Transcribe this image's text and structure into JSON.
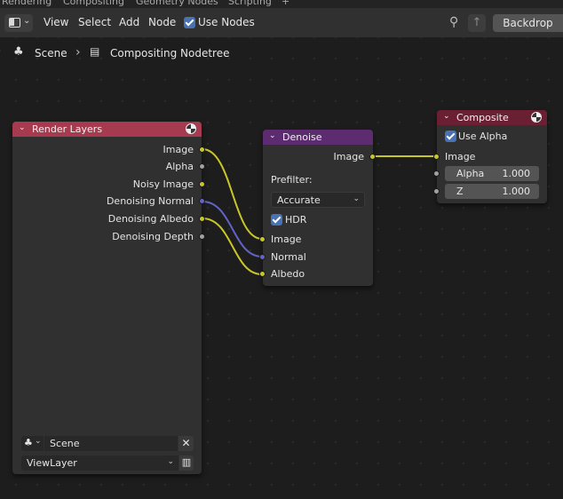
{
  "workspace_tabs": [
    "Rendering",
    "Compositing",
    "Geometry Nodes",
    "Scripting",
    "+"
  ],
  "header": {
    "menus": [
      "View",
      "Select",
      "Add",
      "Node"
    ],
    "use_nodes_label": "Use Nodes",
    "use_nodes_checked": true,
    "backdrop_label": "Backdrop"
  },
  "breadcrumb": {
    "scene": "Scene",
    "separator": "›",
    "nodetree": "Compositing Nodetree"
  },
  "nodes": {
    "render_layers": {
      "title": "Render Layers",
      "header_color": "#a63b4f",
      "outputs": [
        "Image",
        "Alpha",
        "Noisy Image",
        "Denoising Normal",
        "Denoising Albedo",
        "Denoising Depth"
      ],
      "scene_value": "Scene",
      "view_layer_value": "ViewLayer"
    },
    "denoise": {
      "title": "Denoise",
      "header_color": "#5c2b70",
      "output": "Image",
      "prefilter_label": "Prefilter:",
      "prefilter_value": "Accurate",
      "hdr_label": "HDR",
      "hdr_checked": true,
      "inputs": [
        "Image",
        "Normal",
        "Albedo"
      ]
    },
    "composite": {
      "title": "Composite",
      "header_color": "#6b1f33",
      "use_alpha_label": "Use Alpha",
      "use_alpha_checked": true,
      "input_image": "Image",
      "alpha_label": "Alpha",
      "alpha_value": "1.000",
      "z_label": "Z",
      "z_value": "1.000"
    }
  },
  "socket_colors": {
    "color": "#c7c729",
    "float": "#a1a1a1",
    "vector": "#6363c7"
  },
  "links": [
    {
      "from": "Render Layers.Image",
      "to": "Denoise.Image",
      "color": "#c7c729"
    },
    {
      "from": "Render Layers.Denoising Normal",
      "to": "Denoise.Normal",
      "color": "#6363c7"
    },
    {
      "from": "Render Layers.Denoising Albedo",
      "to": "Denoise.Albedo",
      "color": "#c7c729"
    },
    {
      "from": "Denoise.Image",
      "to": "Composite.Image",
      "color": "#c7c729"
    }
  ]
}
